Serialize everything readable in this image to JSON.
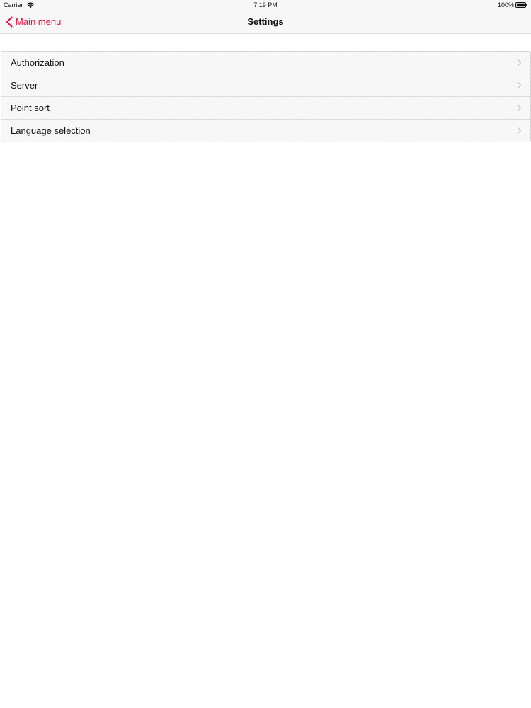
{
  "status_bar": {
    "carrier": "Carrier",
    "time": "7:19 PM",
    "battery": "100%"
  },
  "nav": {
    "back_label": "Main menu",
    "title": "Settings"
  },
  "settings": {
    "items": [
      {
        "label": "Authorization"
      },
      {
        "label": "Server"
      },
      {
        "label": "Point sort"
      },
      {
        "label": "Language selection"
      }
    ]
  },
  "colors": {
    "accent": "#e0174a",
    "chevron": "#c7c7cc"
  },
  "icons": {
    "back": "chevron-left-icon",
    "row": "chevron-right-icon",
    "wifi": "wifi-icon",
    "battery": "battery-icon"
  }
}
